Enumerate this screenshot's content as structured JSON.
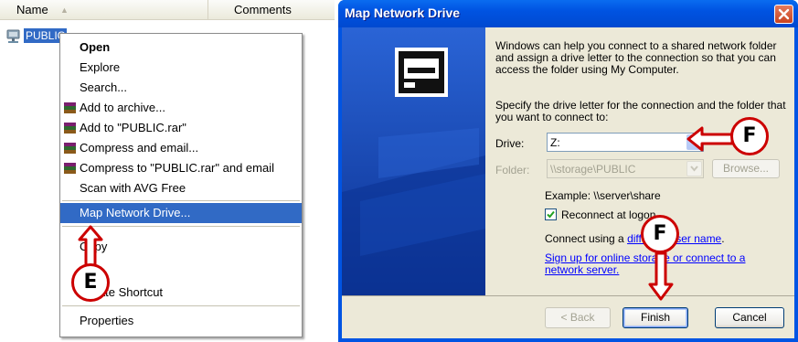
{
  "explorer": {
    "columns": {
      "name": "Name",
      "comments": "Comments"
    },
    "selected_item": "PUBLIC"
  },
  "context_menu": {
    "items": [
      {
        "label": "Open"
      },
      {
        "label": "Explore"
      },
      {
        "label": "Search..."
      },
      {
        "label": "Add to archive..."
      },
      {
        "label": "Add to \"PUBLIC.rar\""
      },
      {
        "label": "Compress and email..."
      },
      {
        "label": "Compress to \"PUBLIC.rar\" and email"
      },
      {
        "label": "Scan with AVG Free"
      },
      {
        "label": "Map Network Drive..."
      },
      {
        "label": "Copy"
      },
      {
        "label": "Create Shortcut"
      },
      {
        "label": "Properties"
      }
    ]
  },
  "dialog": {
    "title": "Map Network Drive",
    "intro": "Windows can help you connect to a shared network folder and assign a drive letter to the connection so that you can access the folder using My Computer.",
    "specify": "Specify the drive letter for the connection and the folder that you want to connect to:",
    "drive_label": "Drive:",
    "drive_value": "Z:",
    "folder_label": "Folder:",
    "folder_value": "\\\\storage\\PUBLIC",
    "browse_label": "Browse...",
    "example": "Example: \\\\server\\share",
    "reconnect_label": "Reconnect at logon",
    "connect_prefix": "Connect using a ",
    "connect_link": "different user name",
    "signup_link": "Sign up for online storage or connect to a network server.",
    "back_label": "< Back",
    "finish_label": "Finish",
    "cancel_label": "Cancel"
  },
  "annotations": {
    "e_label": "E",
    "f_drive_label": "F",
    "f_finish_label": "F",
    "color": "#cc0000"
  }
}
